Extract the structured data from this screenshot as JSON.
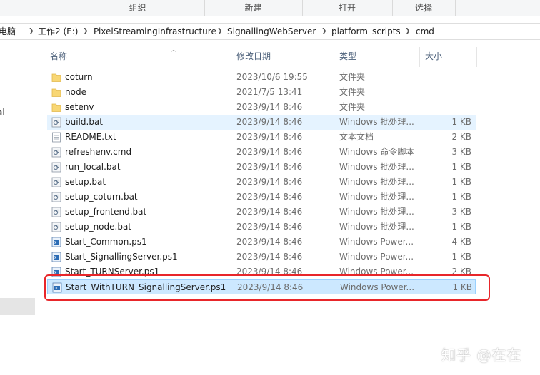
{
  "ribbon": {
    "groups": [
      "组织",
      "新建",
      "打开",
      "选择"
    ]
  },
  "address": {
    "crumbs": [
      "此电脑",
      "工作2 (E:)",
      "PixelStreamingInfrastructure",
      "SignallingWebServer",
      "platform_scripts",
      "cmd"
    ],
    "crumbs_visible": [
      "电脑",
      "工作2 (E:)",
      "PixelStreamingInfrastructure",
      "SignallingWebServer",
      "platform_scripts",
      "cmd"
    ]
  },
  "nav": {
    "fragment": "al"
  },
  "columns": {
    "name": "名称",
    "date": "修改日期",
    "type": "类型",
    "size": "大小"
  },
  "files": [
    {
      "name": "coturn",
      "date": "2023/10/6 19:55",
      "type": "文件夹",
      "size": "",
      "kind": "folder"
    },
    {
      "name": "node",
      "date": "2021/7/5 13:41",
      "type": "文件夹",
      "size": "",
      "kind": "folder"
    },
    {
      "name": "setenv",
      "date": "2023/9/14 8:46",
      "type": "文件夹",
      "size": "",
      "kind": "folder"
    },
    {
      "name": "build.bat",
      "date": "2023/9/14 8:46",
      "type": "Windows 批处理...",
      "size": "1 KB",
      "kind": "bat"
    },
    {
      "name": "README.txt",
      "date": "2023/9/14 8:46",
      "type": "文本文档",
      "size": "2 KB",
      "kind": "txt"
    },
    {
      "name": "refreshenv.cmd",
      "date": "2023/9/14 8:46",
      "type": "Windows 命令脚本",
      "size": "3 KB",
      "kind": "bat"
    },
    {
      "name": "run_local.bat",
      "date": "2023/9/14 8:46",
      "type": "Windows 批处理...",
      "size": "1 KB",
      "kind": "bat"
    },
    {
      "name": "setup.bat",
      "date": "2023/9/14 8:46",
      "type": "Windows 批处理...",
      "size": "1 KB",
      "kind": "bat"
    },
    {
      "name": "setup_coturn.bat",
      "date": "2023/9/14 8:46",
      "type": "Windows 批处理...",
      "size": "1 KB",
      "kind": "bat"
    },
    {
      "name": "setup_frontend.bat",
      "date": "2023/9/14 8:46",
      "type": "Windows 批处理...",
      "size": "3 KB",
      "kind": "bat"
    },
    {
      "name": "setup_node.bat",
      "date": "2023/9/14 8:46",
      "type": "Windows 批处理...",
      "size": "1 KB",
      "kind": "bat"
    },
    {
      "name": "Start_Common.ps1",
      "date": "2023/9/14 8:46",
      "type": "Windows Power...",
      "size": "4 KB",
      "kind": "ps1"
    },
    {
      "name": "Start_SignallingServer.ps1",
      "date": "2023/9/14 8:46",
      "type": "Windows Power...",
      "size": "1 KB",
      "kind": "ps1"
    },
    {
      "name": "Start_TURNServer.ps1",
      "date": "2023/9/14 8:46",
      "type": "Windows Power...",
      "size": "2 KB",
      "kind": "ps1"
    },
    {
      "name": "Start_WithTURN_SignallingServer.ps1",
      "date": "2023/9/14 8:46",
      "type": "Windows Power...",
      "size": "1 KB",
      "kind": "ps1"
    }
  ],
  "selected_index": 14,
  "hover_index": 3,
  "colors": {
    "selection": "#cce8ff",
    "hover": "#e5f3ff",
    "annotation": "#e8262a"
  },
  "watermark": "知乎 @在在"
}
